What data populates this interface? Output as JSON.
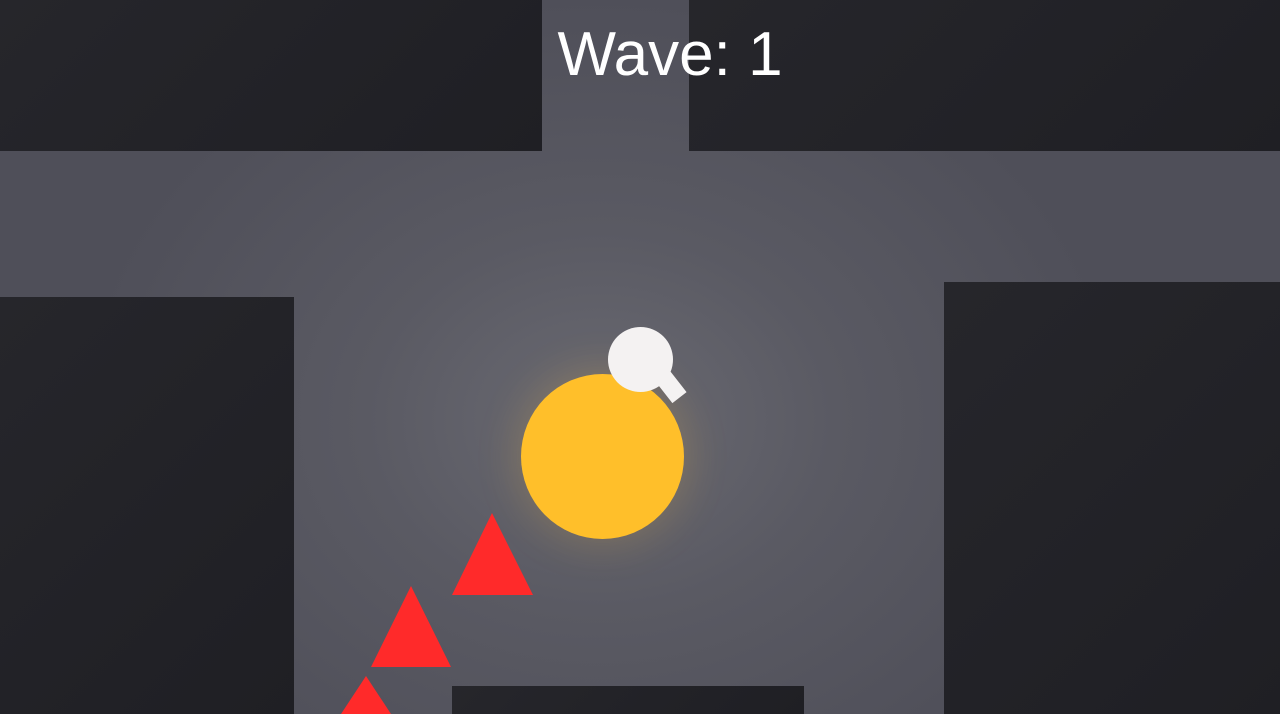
{
  "hud": {
    "wave_label": "Wave:",
    "wave_number": "1"
  },
  "colors": {
    "floor": "#5a5a63",
    "wall": "#222227",
    "player": "#ffbf2a",
    "gun": "#f4f2f2",
    "enemy": "#ff2a2a",
    "text": "#ffffff"
  },
  "entities": {
    "player": {
      "shape": "circle",
      "icon": "player-circle"
    },
    "gun": {
      "shape": "circle-with-barrel",
      "icon": "gun-turret"
    },
    "enemies": [
      {
        "shape": "triangle",
        "icon": "enemy-triangle"
      },
      {
        "shape": "triangle",
        "icon": "enemy-triangle"
      },
      {
        "shape": "triangle",
        "icon": "enemy-triangle"
      }
    ]
  }
}
